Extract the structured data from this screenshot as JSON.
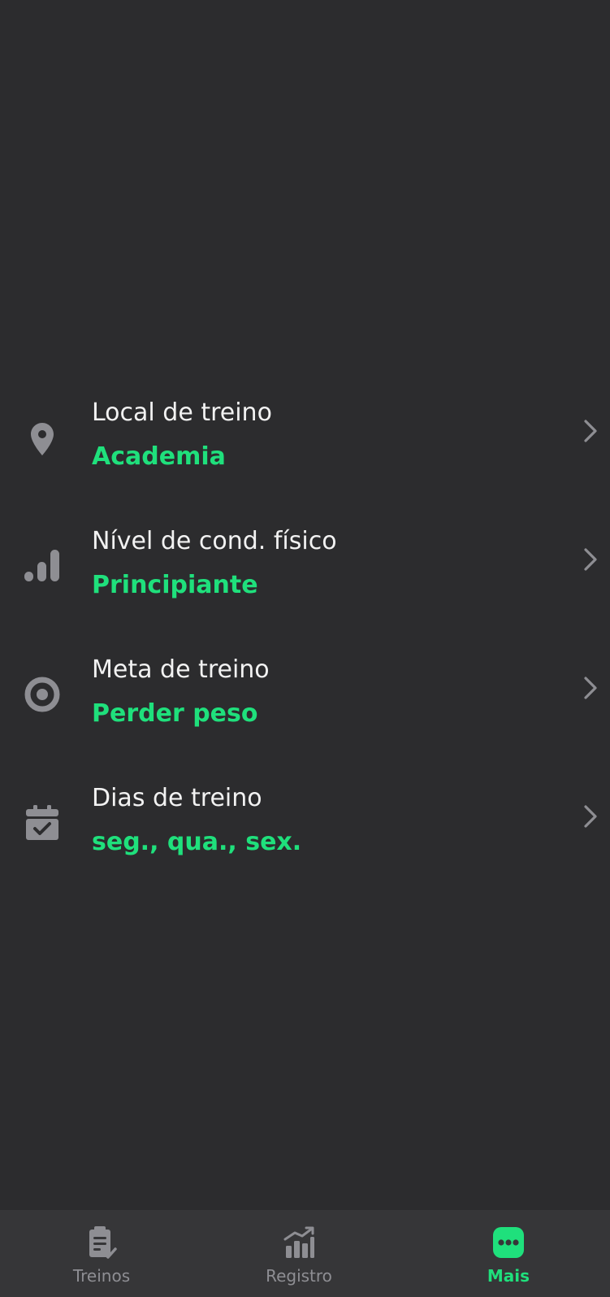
{
  "settings": {
    "items": [
      {
        "icon": "location-pin-icon",
        "title": "Local de treino",
        "value": "Academia"
      },
      {
        "icon": "signal-bars-icon",
        "title": "Nível de cond. físico",
        "value": "Principiante"
      },
      {
        "icon": "target-icon",
        "title": "Meta de treino",
        "value": "Perder peso"
      },
      {
        "icon": "calendar-check-icon",
        "title": "Dias de treino",
        "value": "seg., qua., sex."
      }
    ]
  },
  "tabbar": {
    "tabs": [
      {
        "icon": "clipboard-check-icon",
        "label": "Treinos",
        "active": false
      },
      {
        "icon": "chart-trend-icon",
        "label": "Registro",
        "active": false
      },
      {
        "icon": "more-dots-icon",
        "label": "Mais",
        "active": true
      }
    ]
  },
  "colors": {
    "background": "#2c2c2e",
    "tabbar_background": "#363638",
    "accent": "#1fe07c",
    "text_primary": "#f2f2f2",
    "icon_gray": "#8e8e93"
  }
}
